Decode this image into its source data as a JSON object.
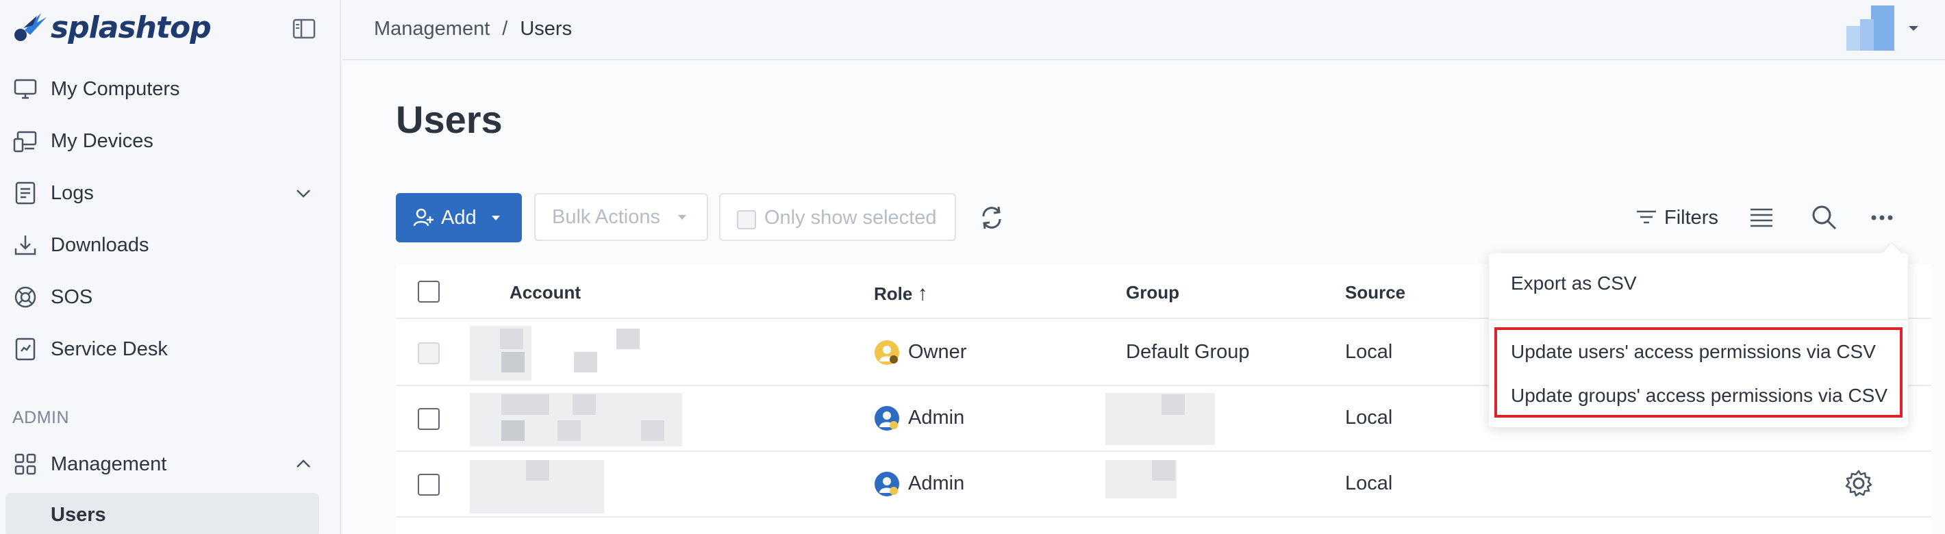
{
  "brand": {
    "name": "splashtop",
    "color": "#1f3a6e"
  },
  "sidebar": {
    "items": [
      {
        "label": "My Computers",
        "icon": "monitor-icon"
      },
      {
        "label": "My Devices",
        "icon": "devices-icon"
      },
      {
        "label": "Logs",
        "icon": "logs-icon",
        "expand": "chevron-down-icon"
      },
      {
        "label": "Downloads",
        "icon": "download-icon"
      },
      {
        "label": "SOS",
        "icon": "sos-icon"
      },
      {
        "label": "Service Desk",
        "icon": "service-desk-icon"
      }
    ],
    "section_label": "ADMIN",
    "management": {
      "label": "Management",
      "icon": "grid-icon",
      "expand": "chevron-up-icon"
    },
    "sub_item": "Users"
  },
  "breadcrumb": {
    "parent": "Management",
    "separator": "/",
    "current": "Users"
  },
  "page": {
    "title": "Users"
  },
  "toolbar": {
    "add_label": "Add",
    "bulk_label": "Bulk Actions",
    "only_selected_label": "Only show selected",
    "filters_label": "Filters"
  },
  "table": {
    "columns": {
      "account": "Account",
      "role": "Role",
      "group": "Group",
      "source": "Source"
    },
    "sort_indicator": "↑",
    "rows": [
      {
        "role": "Owner",
        "group": "Default Group",
        "source": "Local"
      },
      {
        "role": "Admin",
        "group": "",
        "source": "Local"
      },
      {
        "role": "Admin",
        "group": "",
        "source": "Local"
      }
    ]
  },
  "more_menu": {
    "items": [
      "Export as CSV",
      "Update users' access permissions via CSV",
      "Update groups' access permissions via CSV"
    ]
  },
  "colors": {
    "primary": "#2d6cc0",
    "highlight": "#e0202b"
  }
}
